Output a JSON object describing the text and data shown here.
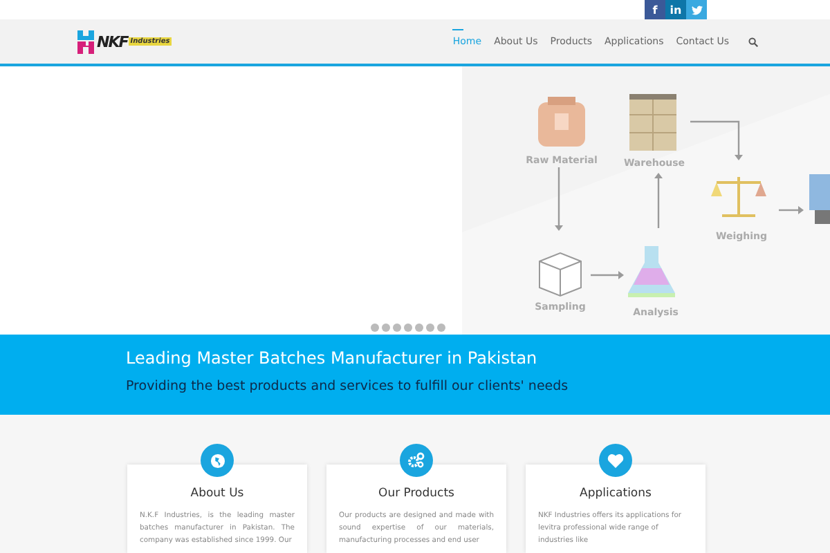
{
  "social_links": [
    {
      "kind": "facebook",
      "label": "f"
    },
    {
      "kind": "linkedin",
      "label": "in"
    },
    {
      "kind": "twitter"
    }
  ],
  "logo": {
    "name": "NKF",
    "suffix": "Industries"
  },
  "nav": [
    {
      "label": "Home",
      "selected": true
    },
    {
      "label": "About Us",
      "selected": false
    },
    {
      "label": "Products",
      "selected": false
    },
    {
      "label": "Applications",
      "selected": false
    },
    {
      "label": "Contact Us",
      "selected": false
    }
  ],
  "slider": {
    "diagram_labels": [
      "Raw Material",
      "Warehouse",
      "Weighing",
      "Sampling",
      "Analysis"
    ],
    "dots": [
      {
        "selected": false
      },
      {
        "selected": false
      },
      {
        "selected": false
      },
      {
        "selected": false
      },
      {
        "selected": false
      },
      {
        "selected": false
      },
      {
        "selected": false
      }
    ]
  },
  "banner": {
    "title": "Leading Master Batches Manufacturer in Pakistan",
    "subtitle": "Providing the best products and services to fulfill our clients' needs"
  },
  "cards": [
    {
      "kind": "globe",
      "title": "About Us",
      "text": "N.K.F Industries, is the leading master batches manufacturer in Pakistan. The company was established since 1999. Our"
    },
    {
      "kind": "gears",
      "title": "Our Products",
      "text": "Our products are designed and made with sound expertise of our materials, manufacturing processes and end user"
    },
    {
      "kind": "heart",
      "title": "Applications",
      "text": "NKF Industries offers its applications for levitra professional wide range of industries like"
    }
  ]
}
